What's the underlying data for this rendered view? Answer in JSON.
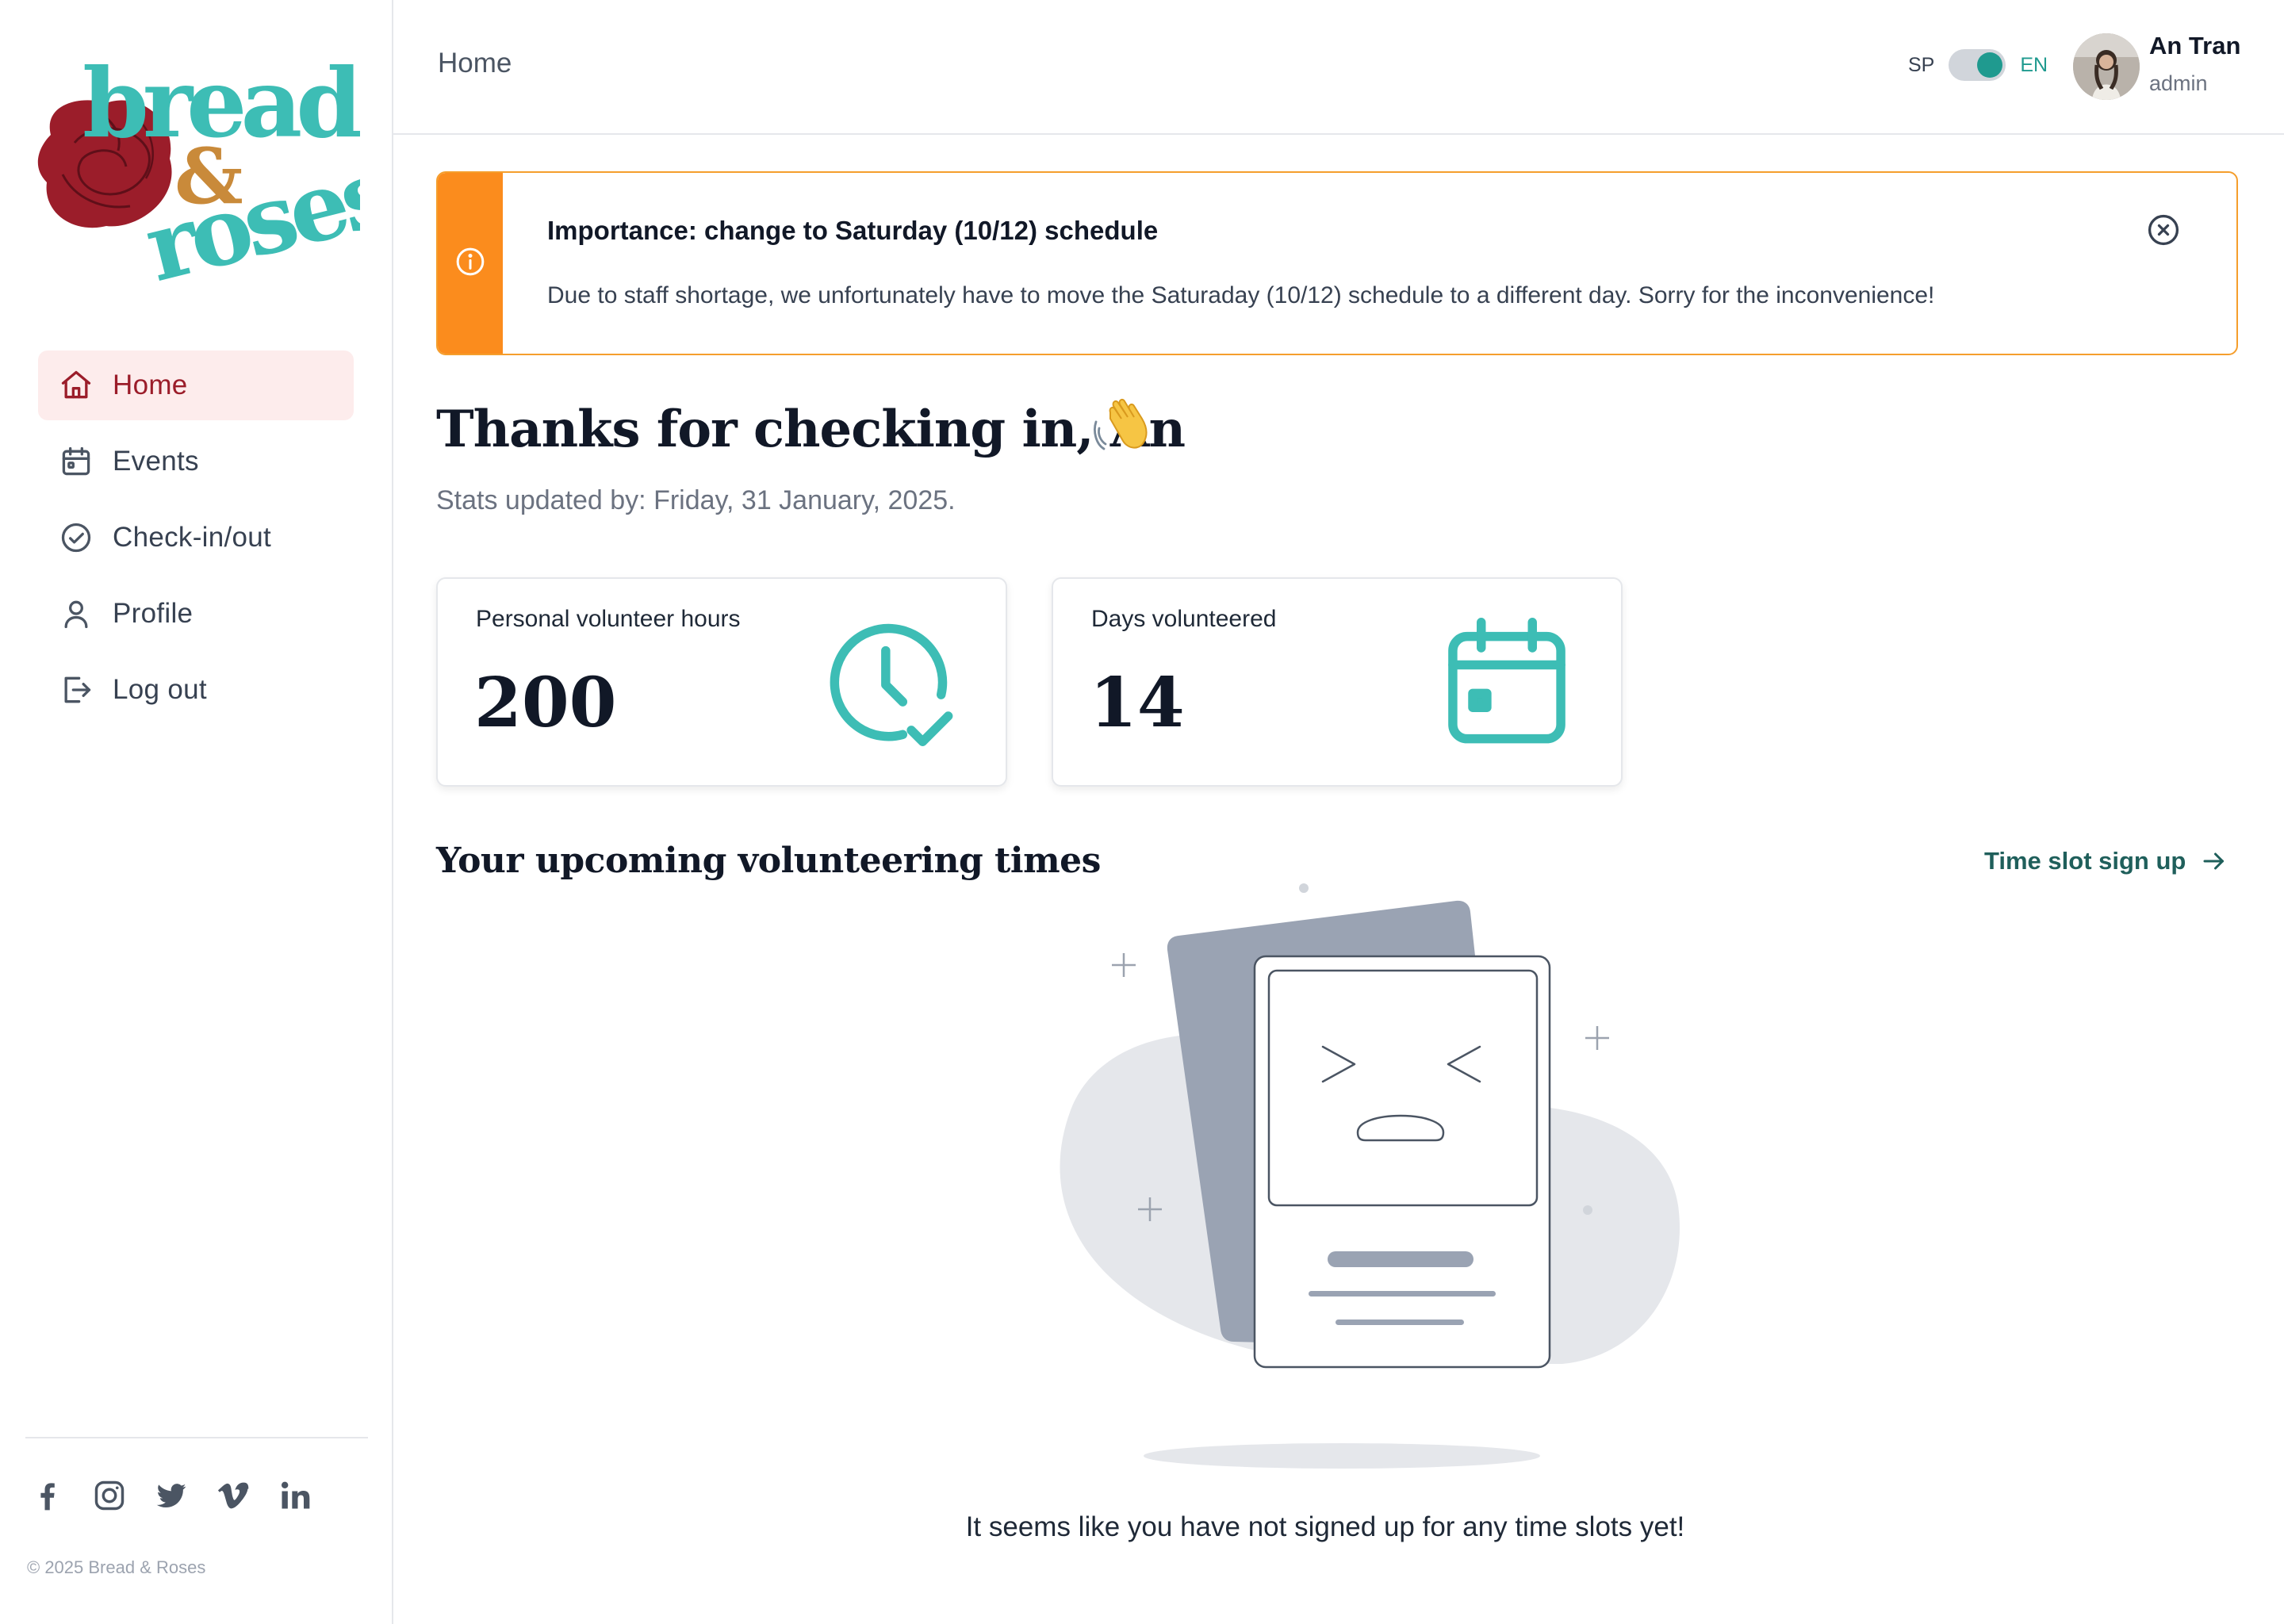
{
  "brand": {
    "logo_word1": "bread",
    "logo_amp": "&",
    "logo_word2": "roses",
    "copyright": "© 2025 Bread & Roses",
    "teal": "#3dbdb5",
    "rose": "#9b1d2a",
    "gold": "#c98a3a"
  },
  "sidebar": {
    "items": [
      {
        "label": "Home",
        "icon": "home-icon",
        "active": true
      },
      {
        "label": "Events",
        "icon": "calendar-icon",
        "active": false
      },
      {
        "label": "Check-in/out",
        "icon": "check-circle-icon",
        "active": false
      },
      {
        "label": "Profile",
        "icon": "user-icon",
        "active": false
      },
      {
        "label": "Log out",
        "icon": "logout-icon",
        "active": false
      }
    ],
    "social": [
      "facebook-icon",
      "instagram-icon",
      "twitter-icon",
      "vimeo-icon",
      "linkedin-icon"
    ]
  },
  "header": {
    "breadcrumb": "Home",
    "lang_left": "SP",
    "lang_right": "EN",
    "lang_selected": "EN",
    "user_name": "An Tran",
    "user_role": "admin"
  },
  "banner": {
    "title": "Importance: change to Saturday (10/12) schedule",
    "body": "Due to staff shortage, we unfortunately have to move the Saturaday (10/12) schedule to a different day. Sorry for the inconvenience!",
    "accent": "#fb8c1d"
  },
  "main": {
    "greeting": "Thanks for checking in, An",
    "greeting_emoji": "waving-hand-icon",
    "stats_updated": "Stats updated by: Friday, 31 January, 2025.",
    "stats": [
      {
        "label": "Personal volunteer hours",
        "value": "200",
        "icon": "clock-check-icon"
      },
      {
        "label": "Days volunteered",
        "value": "14",
        "icon": "calendar-icon"
      }
    ],
    "upcoming_title": "Your upcoming volunteering times",
    "signup_link": "Time slot sign up",
    "empty_message": "It seems like you have not signed up for any time slots yet!"
  }
}
